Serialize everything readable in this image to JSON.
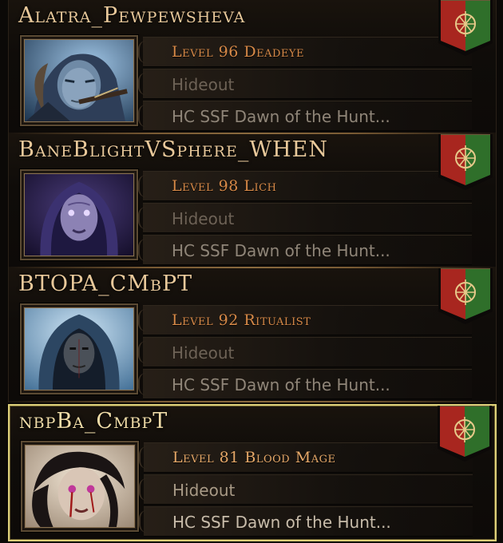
{
  "colors": {
    "name_gold": "#e8c89a",
    "class_orange": "#d88a48",
    "area_grey": "#6d6256",
    "league_grey": "#8f8578",
    "selected_border": "#ddd07a",
    "banner_red": "#a8261f",
    "banner_green": "#2f6f2a"
  },
  "characters": [
    {
      "name": "Alatra_Pewpewsheva",
      "class_label": "Level 96 Deadeye",
      "area": "Hideout",
      "league": "HC SSF Dawn of the Hunt...",
      "portrait": "deadeye-portrait",
      "selected": false
    },
    {
      "name": "BaneBlightVSphere_WHEN",
      "class_label": "Level 98 Lich",
      "area": "Hideout",
      "league": "HC SSF Dawn of the Hunt...",
      "portrait": "lich-portrait",
      "selected": false
    },
    {
      "name": "BTOPA_CMbPT",
      "class_label": "Level 92 Ritualist",
      "area": "Hideout",
      "league": "HC SSF Dawn of the Hunt...",
      "portrait": "ritualist-portrait",
      "selected": false
    },
    {
      "name": "nbpBa_CmbpT",
      "class_label": "Level 81 Blood Mage",
      "area": "Hideout",
      "league": "HC SSF Dawn of the Hunt...",
      "portrait": "blood-mage-portrait",
      "selected": true
    }
  ]
}
